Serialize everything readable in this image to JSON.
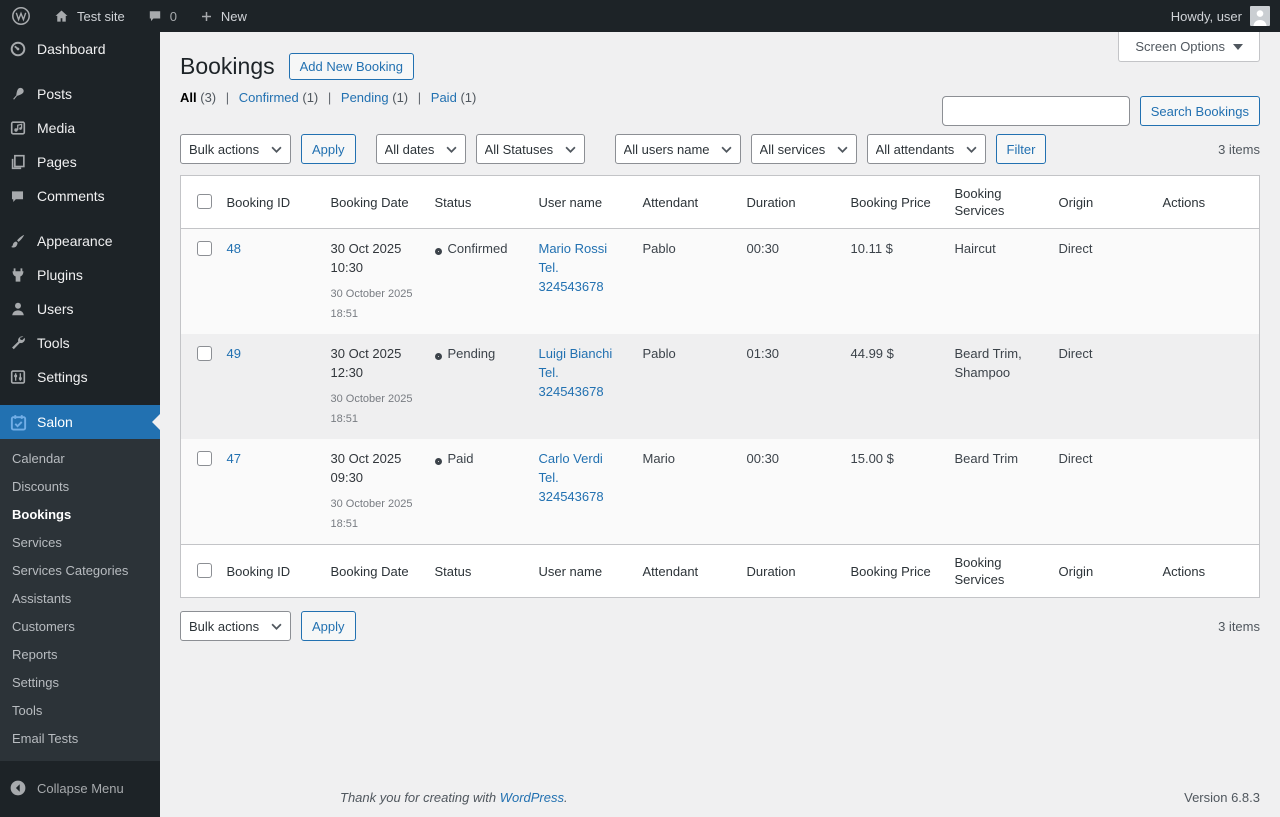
{
  "admin_bar": {
    "site_name": "Test site",
    "comments_count": "0",
    "new_label": "New",
    "howdy": "Howdy, user"
  },
  "sidebar": {
    "items": [
      {
        "label": "Dashboard",
        "icon": "dashboard-icon"
      },
      {
        "label": "Posts",
        "icon": "pushpin-icon"
      },
      {
        "label": "Media",
        "icon": "media-icon"
      },
      {
        "label": "Pages",
        "icon": "pages-icon"
      },
      {
        "label": "Comments",
        "icon": "comment-bubble-icon"
      },
      {
        "label": "Appearance",
        "icon": "paintbrush-icon"
      },
      {
        "label": "Plugins",
        "icon": "plugin-icon"
      },
      {
        "label": "Users",
        "icon": "user-icon"
      },
      {
        "label": "Tools",
        "icon": "wrench-icon"
      },
      {
        "label": "Settings",
        "icon": "sliders-icon"
      },
      {
        "label": "Salon",
        "icon": "calendar-check-icon"
      }
    ],
    "salon_submenu": [
      {
        "label": "Calendar"
      },
      {
        "label": "Discounts"
      },
      {
        "label": "Bookings",
        "current": true
      },
      {
        "label": "Services"
      },
      {
        "label": "Services Categories"
      },
      {
        "label": "Assistants"
      },
      {
        "label": "Customers"
      },
      {
        "label": "Reports"
      },
      {
        "label": "Settings"
      },
      {
        "label": "Tools"
      },
      {
        "label": "Email Tests"
      }
    ],
    "collapse_label": "Collapse Menu"
  },
  "header": {
    "title": "Bookings",
    "add_new_label": "Add New Booking",
    "screen_options_label": "Screen Options"
  },
  "views": {
    "all_label": "All",
    "all_count": "(3)",
    "confirmed_label": "Confirmed",
    "confirmed_count": "(1)",
    "pending_label": "Pending",
    "pending_count": "(1)",
    "paid_label": "Paid",
    "paid_count": "(1)"
  },
  "search": {
    "value": "",
    "button_label": "Search Bookings"
  },
  "filters": {
    "bulk_actions_label": "Bulk actions",
    "apply_label": "Apply",
    "all_dates": "All dates",
    "all_statuses": "All Statuses",
    "all_users": "All users name",
    "all_services": "All services",
    "all_attendants": "All attendants",
    "filter_label": "Filter",
    "items_count": "3 items"
  },
  "table": {
    "columns": [
      "Booking ID",
      "Booking Date",
      "Status",
      "User name",
      "Attendant",
      "Duration",
      "Booking Price",
      "Booking Services",
      "Origin",
      "Actions"
    ],
    "rows": [
      {
        "id": "48",
        "date_main": "30 Oct 2025 10:30",
        "date_sub": "30 October 2025 18:51",
        "status": "Confirmed",
        "user": "Mario Rossi Tel. 324543678",
        "attendant": "Pablo",
        "duration": "00:30",
        "price": "10.11 $",
        "services": "Haircut",
        "origin": "Direct"
      },
      {
        "id": "49",
        "date_main": "30 Oct 2025 12:30",
        "date_sub": "30 October 2025 18:51",
        "status": "Pending",
        "user": "Luigi Bianchi Tel. 324543678",
        "attendant": "Pablo",
        "duration": "01:30",
        "price": "44.99 $",
        "services": "Beard Trim, Shampoo",
        "origin": "Direct"
      },
      {
        "id": "47",
        "date_main": "30 Oct 2025 09:30",
        "date_sub": "30 October 2025 18:51",
        "status": "Paid",
        "user": "Carlo Verdi Tel. 324543678",
        "attendant": "Mario",
        "duration": "00:30",
        "price": "15.00 $",
        "services": "Beard Trim",
        "origin": "Direct"
      }
    ]
  },
  "footer": {
    "thanks_prefix": "Thank you for creating with ",
    "wordpress_link": "WordPress",
    "thanks_suffix": ".",
    "version": "Version 6.8.3"
  },
  "colors": {
    "accent_blue": "#2271b1",
    "link_blue": "#2271b1",
    "status_confirmed": "#1e8c1e",
    "status_pending": "#f5a623",
    "status_paid": "#1e8c1e",
    "admin_bar_bg": "#1d2327",
    "sidebar_bg": "#1d2327",
    "submenu_bg": "#2c3338",
    "menu_highlight": "#2271b1",
    "salon_icon_blue": "#72aee6"
  }
}
